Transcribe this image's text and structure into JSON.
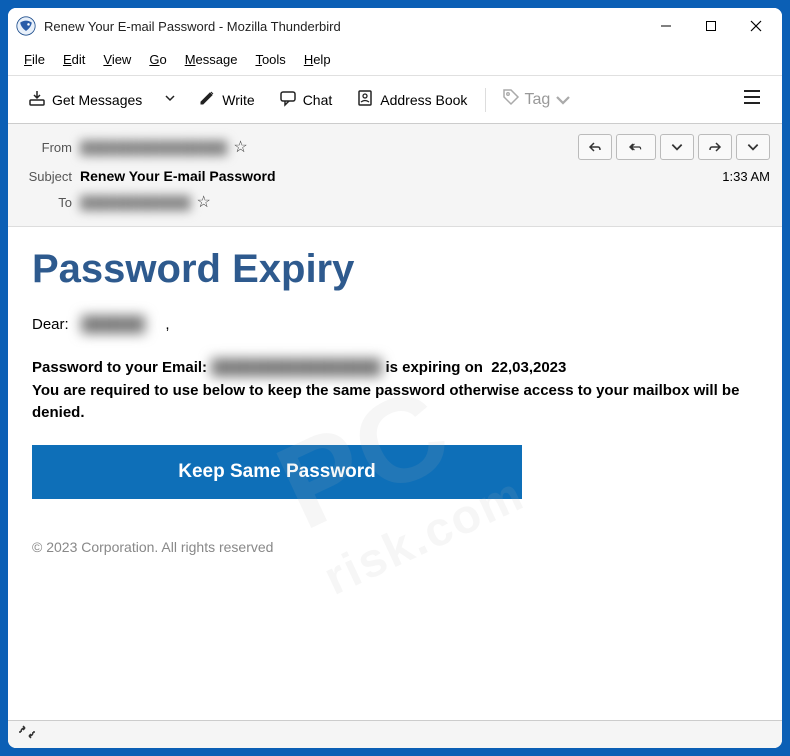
{
  "window": {
    "title": "Renew Your E-mail Password - Mozilla Thunderbird"
  },
  "menubar": {
    "file": "File",
    "edit": "Edit",
    "view": "View",
    "go": "Go",
    "message": "Message",
    "tools": "Tools",
    "help": "Help"
  },
  "toolbar": {
    "get_messages": "Get Messages",
    "write": "Write",
    "chat": "Chat",
    "address_book": "Address Book",
    "tag": "Tag"
  },
  "headers": {
    "from_label": "From",
    "subject_label": "Subject",
    "to_label": "To",
    "subject_value": "Renew Your E-mail Password",
    "time": "1:33 AM",
    "from_blur": "████████████████",
    "to_blur": "████████████"
  },
  "body": {
    "title": "Password Expiry",
    "dear": "Dear:",
    "name_blur": "██████",
    "comma": ",",
    "line1a": "Password to your Email:",
    "email_blur": "████████████████",
    "line1b": "is expiring on",
    "date": "22,03,2023",
    "line2": "You are required to use below to keep the same password otherwise access to your mailbox will be denied.",
    "cta": "Keep Same Password",
    "footer": "© 2023  Corporation. All rights reserved"
  },
  "watermark": {
    "top": "PC",
    "bottom": "risk.com"
  }
}
